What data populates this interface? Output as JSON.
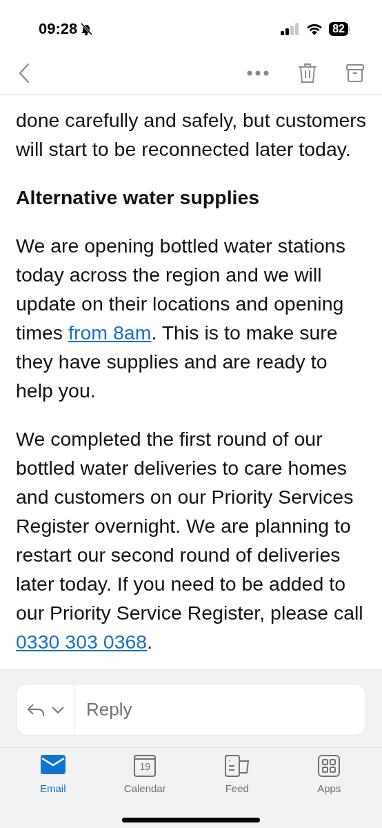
{
  "status_bar": {
    "time": "09:28",
    "silent": true,
    "battery": "82"
  },
  "toolbar": {
    "back": true
  },
  "email": [
    {
      "kind": "paragraph",
      "parts": [
        {
          "kind": "text",
          "text": "done carefully and safely, but customers will start to be reconnected later today."
        }
      ]
    },
    {
      "kind": "heading",
      "parts": [
        {
          "kind": "text",
          "text": "Alternative water supplies"
        }
      ]
    },
    {
      "kind": "paragraph",
      "parts": [
        {
          "kind": "text",
          "text": "We are opening bottled water stations today across the region and we will update on their locations and opening times "
        },
        {
          "kind": "link",
          "text": "from 8am"
        },
        {
          "kind": "text",
          "text": ". This is to make sure they have supplies and are ready to help you."
        }
      ]
    },
    {
      "kind": "paragraph",
      "parts": [
        {
          "kind": "text",
          "text": "We completed the first round of our bottled water deliveries to care homes and customers on our Priority Services Register overnight. We are planning to restart our second round of deliveries later today. If you need to be added to our Priority Service Register, please call "
        },
        {
          "kind": "link",
          "text": "0330 303 0368"
        },
        {
          "kind": "text",
          "text": "."
        }
      ]
    }
  ],
  "reply": {
    "placeholder": "Reply"
  },
  "tabs": [
    {
      "kind": "email",
      "label": "Email",
      "selected": true
    },
    {
      "kind": "calendar",
      "label": "Calendar",
      "icon_text": "19",
      "selected": false
    },
    {
      "kind": "feed",
      "label": "Feed",
      "selected": false
    },
    {
      "kind": "apps",
      "label": "Apps",
      "selected": false
    }
  ]
}
